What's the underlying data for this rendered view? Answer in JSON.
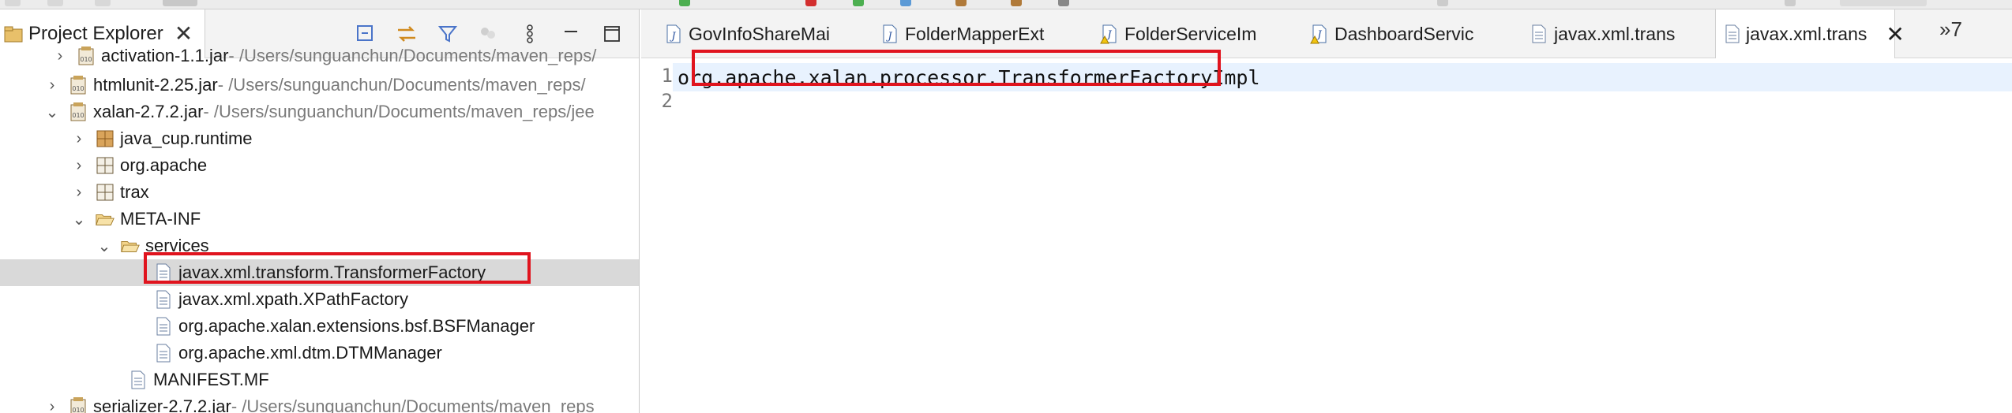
{
  "colors": {
    "selection": "#d9d9d9",
    "line_highlight": "#e8f2fe",
    "annotation_red": "#e0141e",
    "accent_blue": "#4a74c9"
  },
  "explorer": {
    "title": "Project Explorer",
    "actions": [
      "collapse-all-icon",
      "link-with-editor-icon",
      "filter-icon",
      "more-options-icon",
      "minimize-icon",
      "maximize-icon"
    ],
    "rows": [
      {
        "name": "activation-1.1.jar",
        "path": " - /Users/sunguanchun/Documents/maven_reps/",
        "icon": "jar-icon"
      },
      {
        "name": "htmlunit-2.25.jar",
        "path": " - /Users/sunguanchun/Documents/maven_reps/",
        "icon": "jar-icon"
      },
      {
        "name": "xalan-2.7.2.jar",
        "path": " - /Users/sunguanchun/Documents/maven_reps/jee",
        "icon": "jar-icon"
      },
      {
        "name": "java_cup.runtime",
        "path": "",
        "icon": "package-icon"
      },
      {
        "name": "org.apache",
        "path": "",
        "icon": "package-icon"
      },
      {
        "name": "trax",
        "path": "",
        "icon": "package-icon"
      },
      {
        "name": "META-INF",
        "path": "",
        "icon": "folder-open-icon"
      },
      {
        "name": "services",
        "path": "",
        "icon": "folder-open-icon"
      },
      {
        "name": "javax.xml.transform.TransformerFactory",
        "path": "",
        "icon": "file-icon"
      },
      {
        "name": "javax.xml.xpath.XPathFactory",
        "path": "",
        "icon": "file-icon"
      },
      {
        "name": "org.apache.xalan.extensions.bsf.BSFManager",
        "path": "",
        "icon": "file-icon"
      },
      {
        "name": "org.apache.xml.dtm.DTMManager",
        "path": "",
        "icon": "file-icon"
      },
      {
        "name": "MANIFEST.MF",
        "path": "",
        "icon": "file-icon"
      },
      {
        "name": "serializer-2.7.2.jar",
        "path": " - /Users/sunguanchun/Documents/maven_reps",
        "icon": "jar-icon"
      }
    ]
  },
  "editor": {
    "tabs": [
      {
        "label": "GovInfoShareMai",
        "icon": "java-file-icon"
      },
      {
        "label": "FolderMapperExt",
        "icon": "java-file-icon"
      },
      {
        "label": "FolderServiceIm",
        "icon": "java-file-warning-icon"
      },
      {
        "label": "DashboardServic",
        "icon": "java-file-warning-icon"
      },
      {
        "label": "javax.xml.trans",
        "icon": "text-file-icon"
      },
      {
        "label": "javax.xml.trans",
        "icon": "text-file-icon"
      }
    ],
    "more_tabs": "»7",
    "line_numbers": [
      "1",
      "2"
    ],
    "code_line_1": "org.apache.xalan.processor.TransformerFactoryImpl"
  }
}
